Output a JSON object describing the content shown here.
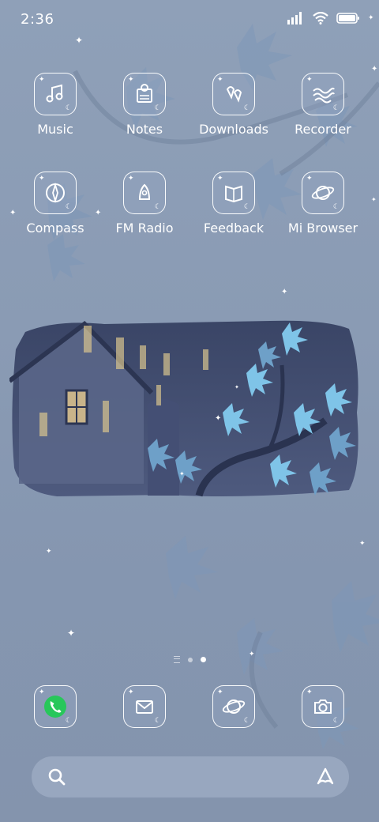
{
  "status_bar": {
    "time": "2:36"
  },
  "apps": [
    {
      "label": "Music",
      "icon": "music-note-icon"
    },
    {
      "label": "Notes",
      "icon": "notes-icon"
    },
    {
      "label": "Downloads",
      "icon": "downloads-icon"
    },
    {
      "label": "Recorder",
      "icon": "recorder-icon"
    },
    {
      "label": "Compass",
      "icon": "compass-icon"
    },
    {
      "label": "FM Radio",
      "icon": "radio-icon"
    },
    {
      "label": "Feedback",
      "icon": "feedback-icon"
    },
    {
      "label": "Mi Browser",
      "icon": "planet-icon"
    }
  ],
  "pager": {
    "pages": 2,
    "active": 2
  },
  "dock": [
    {
      "icon": "phone-icon",
      "accent": "#27c75a"
    },
    {
      "icon": "messages-icon"
    },
    {
      "icon": "browser-planet-icon"
    },
    {
      "icon": "camera-icon"
    }
  ],
  "colors": {
    "background": "#8a9bb4",
    "leaf": "#6ea0c8",
    "leaf_bright": "#7fc4e8"
  }
}
